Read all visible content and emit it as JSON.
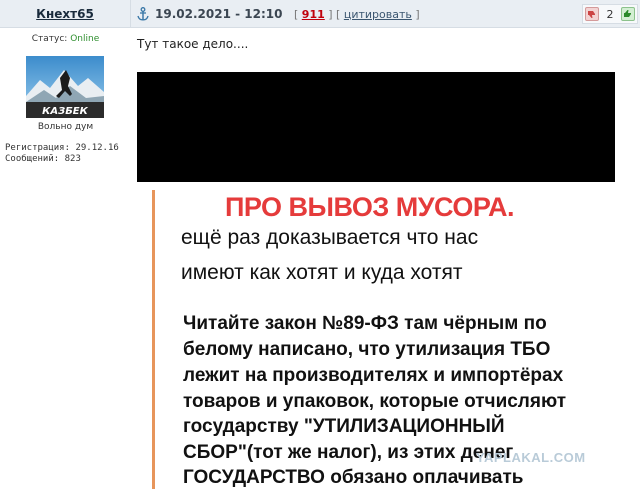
{
  "author": {
    "name": "Кнехт65"
  },
  "post_header": {
    "date": "19.02.2021 - 12:10",
    "number": "911",
    "quote_label": "цитировать",
    "rating": "2"
  },
  "user_panel": {
    "status_label": "Статус: ",
    "status_value": "Online",
    "avatar_text": "КАЗБЕК",
    "title": "Вольно дум",
    "registration": "Регистрация: 29.12.16",
    "messages": "Сообщений: 823"
  },
  "post": {
    "text": "Тут такое дело....",
    "image": {
      "headline": "ПРО ВЫВОЗ МУСОРА.",
      "subline_1": "ещё раз доказывается что нас",
      "subline_2": "имеют как хотят и куда хотят",
      "body_lines": [
        "Читайте закон №89-ФЗ там чёрным по",
        "белому написано, что утилизация ТБО",
        "лежит на производителях и импортёрах",
        "товаров и упаковок, которые отчисляют",
        "государству \"УТИЛИЗАЦИОННЫЙ",
        "СБОР\"(тот же налог), из этих денег",
        "ГОСУДАРСТВО обязано оплачивать"
      ]
    }
  },
  "watermark": "YAPLAKAL.COM",
  "colors": {
    "header_bg": "#e9eef3",
    "post_number": "#c0000b",
    "online": "#2f8f2f",
    "headline": "#e53b3b"
  },
  "icons": {
    "anchor": "anchor-icon",
    "vote_down": "thumb-down-icon",
    "vote_up": "thumb-up-icon"
  }
}
